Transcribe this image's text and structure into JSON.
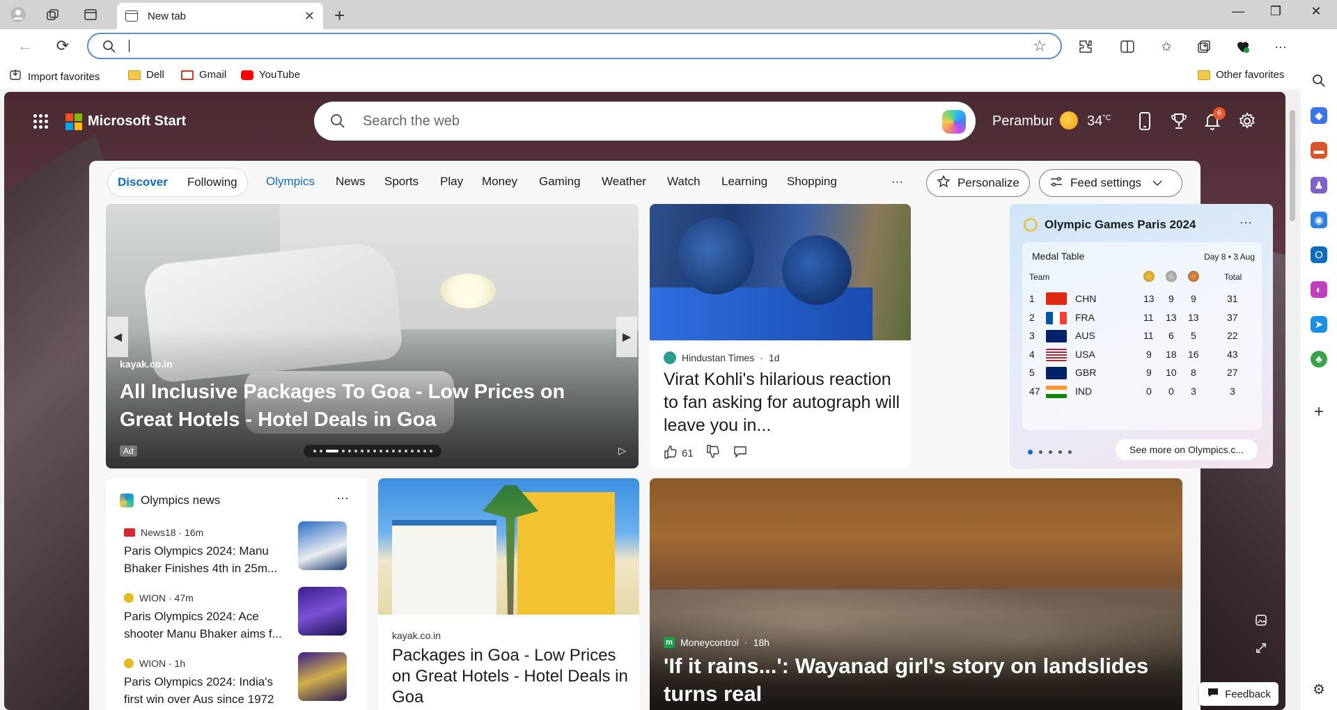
{
  "browser": {
    "tab_title": "New tab",
    "address_value": "",
    "favorites": [
      {
        "label": "Import favorites"
      },
      {
        "label": "Dell"
      },
      {
        "label": "Gmail"
      },
      {
        "label": "YouTube"
      }
    ],
    "other_favorites": "Other favorites"
  },
  "header": {
    "brand": "Microsoft Start",
    "search_placeholder": "Search the web",
    "location": "Perambur",
    "temperature": "34",
    "temp_unit": "°C",
    "notification_count": "6"
  },
  "nav": {
    "discover": "Discover",
    "following": "Following",
    "items": [
      "Olympics",
      "News",
      "Sports",
      "Play",
      "Money",
      "Gaming",
      "Weather",
      "Watch",
      "Learning",
      "Shopping"
    ],
    "more": "···",
    "personalize": "Personalize",
    "feed_settings": "Feed settings"
  },
  "hero": {
    "source": "kayak.co.in",
    "headline": "All Inclusive Packages To Goa - Low Prices on Great Hotels - Hotel Deals in Goa",
    "ad_label": "Ad"
  },
  "kohli": {
    "publisher": "Hindustan Times",
    "age": "1d",
    "title": "Virat Kohli's hilarious reaction to fan asking for autograph will leave you in...",
    "likes": "61"
  },
  "olympics": {
    "title": "Olympic Games Paris 2024",
    "more": "···",
    "table_title": "Medal Table",
    "day": "Day 8 • 3 Aug",
    "col_team": "Team",
    "col_total": "Total",
    "rows": [
      {
        "rank": "1",
        "team": "CHN",
        "gold": "13",
        "silver": "9",
        "bronze": "9",
        "total": "31"
      },
      {
        "rank": "2",
        "team": "FRA",
        "gold": "11",
        "silver": "13",
        "bronze": "13",
        "total": "37"
      },
      {
        "rank": "3",
        "team": "AUS",
        "gold": "11",
        "silver": "6",
        "bronze": "5",
        "total": "22"
      },
      {
        "rank": "4",
        "team": "USA",
        "gold": "9",
        "silver": "18",
        "bronze": "16",
        "total": "43"
      },
      {
        "rank": "5",
        "team": "GBR",
        "gold": "9",
        "silver": "10",
        "bronze": "8",
        "total": "27"
      },
      {
        "rank": "47",
        "team": "IND",
        "gold": "0",
        "silver": "0",
        "bronze": "3",
        "total": "3"
      }
    ],
    "see_more": "See more on Olympics.c..."
  },
  "olympics_news": {
    "title": "Olympics news",
    "more": "···",
    "items": [
      {
        "meta": "News18 · 16m",
        "title": "Paris Olympics 2024: Manu Bhaker Finishes 4th in 25m..."
      },
      {
        "meta": "WION · 47m",
        "title": "Paris Olympics 2024: Ace shooter Manu Bhaker aims f..."
      },
      {
        "meta": "WION · 1h",
        "title": "Paris Olympics 2024: India's first win over Aus since 1972"
      }
    ]
  },
  "goa": {
    "source": "kayak.co.in",
    "title": "Packages in Goa - Low Prices on Great Hotels - Hotel Deals in Goa"
  },
  "wayanad": {
    "publisher": "Moneycontrol",
    "age": "18h",
    "headline": "'If it rains...': Wayanad girl's story on landslides turns real"
  },
  "feedback": "Feedback"
}
